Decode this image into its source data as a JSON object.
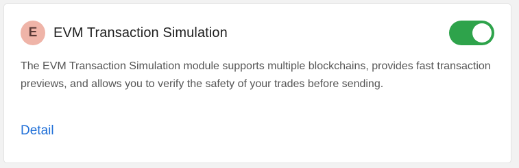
{
  "module": {
    "avatar_letter": "E",
    "title": "EVM Transaction Simulation",
    "enabled": true,
    "description": "The EVM Transaction Simulation module supports multiple blockchains, provides fast transaction previews, and allows you to verify the safety of your trades before sending.",
    "detail_link_label": "Detail"
  },
  "colors": {
    "avatar_bg": "#efb4a8",
    "toggle_on": "#2ea34b",
    "link": "#1f6fd8"
  }
}
